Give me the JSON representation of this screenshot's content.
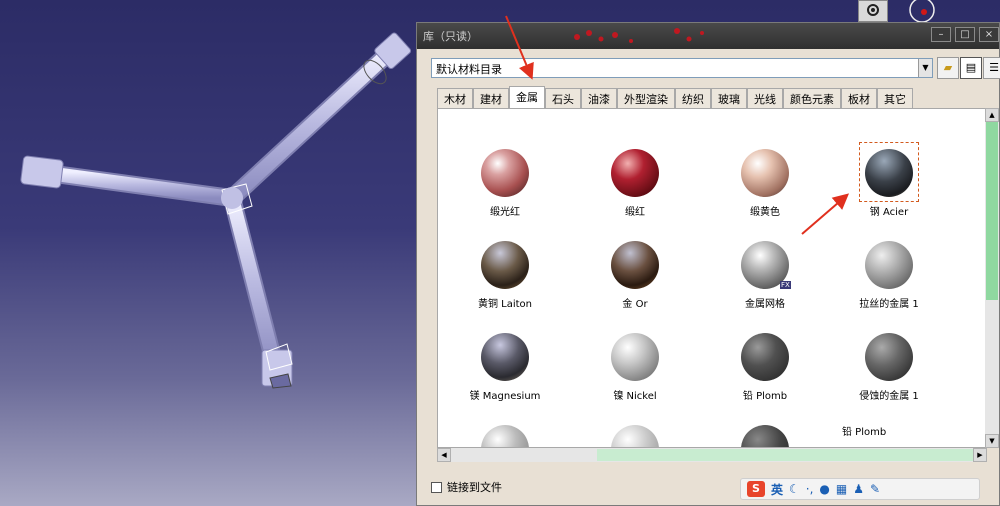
{
  "window": {
    "title": "库（只读）"
  },
  "catalog": {
    "selected": "默认材料目录"
  },
  "tabs": [
    {
      "label": "木材"
    },
    {
      "label": "建材"
    },
    {
      "label": "金属"
    },
    {
      "label": "石头"
    },
    {
      "label": "油漆"
    },
    {
      "label": "外型渲染"
    },
    {
      "label": "纺织"
    },
    {
      "label": "玻璃"
    },
    {
      "label": "光线"
    },
    {
      "label": "颜色元素"
    },
    {
      "label": "板材"
    },
    {
      "label": "其它"
    }
  ],
  "materials": [
    {
      "label": "缎光红"
    },
    {
      "label": "缎红"
    },
    {
      "label": "缎黄色"
    },
    {
      "label": "钢 Acier"
    },
    {
      "label": "黄铜 Laiton"
    },
    {
      "label": "金 Or"
    },
    {
      "label": "金属网格"
    },
    {
      "label": "拉丝的金属 1"
    },
    {
      "label": "镁 Magnesium"
    },
    {
      "label": "镍 Nickel"
    },
    {
      "label": "铅 Plomb"
    },
    {
      "label": "侵蚀的金属 1"
    }
  ],
  "tooltip": "铅 Plomb",
  "badge": "FX",
  "link_checkbox": {
    "label": "链接到文件"
  },
  "ime": {
    "lang": "英",
    "logo": "S"
  },
  "colors": {
    "annotation_arrow": "#e0301e",
    "selection": "#d25a1e"
  }
}
